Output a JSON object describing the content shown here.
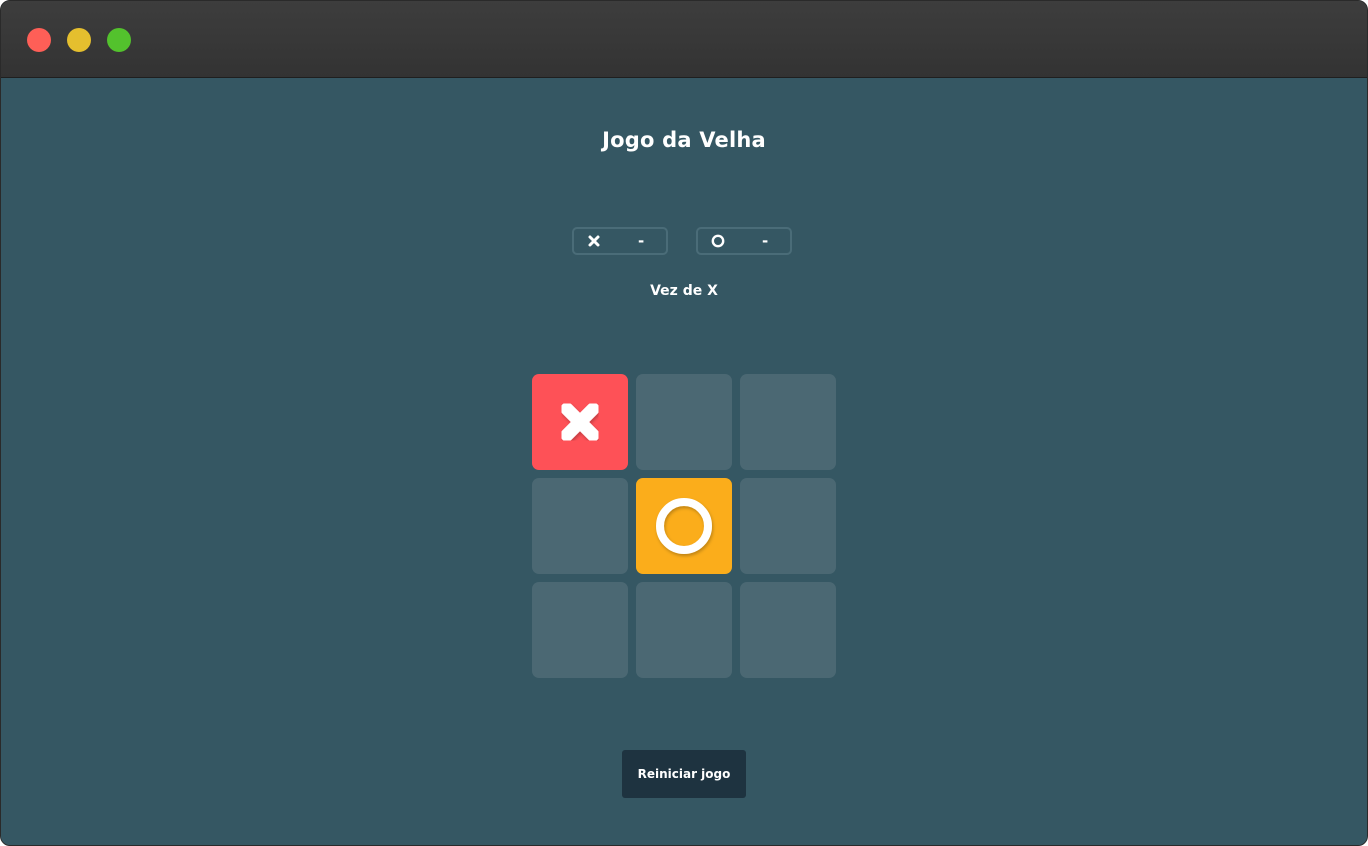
{
  "window": {
    "controls": [
      "close",
      "minimize",
      "maximize"
    ]
  },
  "game": {
    "title": "Jogo da Velha",
    "scores": [
      {
        "player": "X",
        "icon": "x-icon",
        "value": "-"
      },
      {
        "player": "O",
        "icon": "o-icon",
        "value": "-"
      }
    ],
    "turn_text": "Vez de X",
    "board": [
      "X",
      "",
      "",
      "",
      "O",
      "",
      "",
      "",
      ""
    ],
    "restart_label": "Reiniciar jogo"
  },
  "colors": {
    "background": "#355763",
    "empty_cell": "#4b6873",
    "x_cell": "#fe5157",
    "o_cell": "#fbad1b",
    "button": "#1e3340"
  }
}
